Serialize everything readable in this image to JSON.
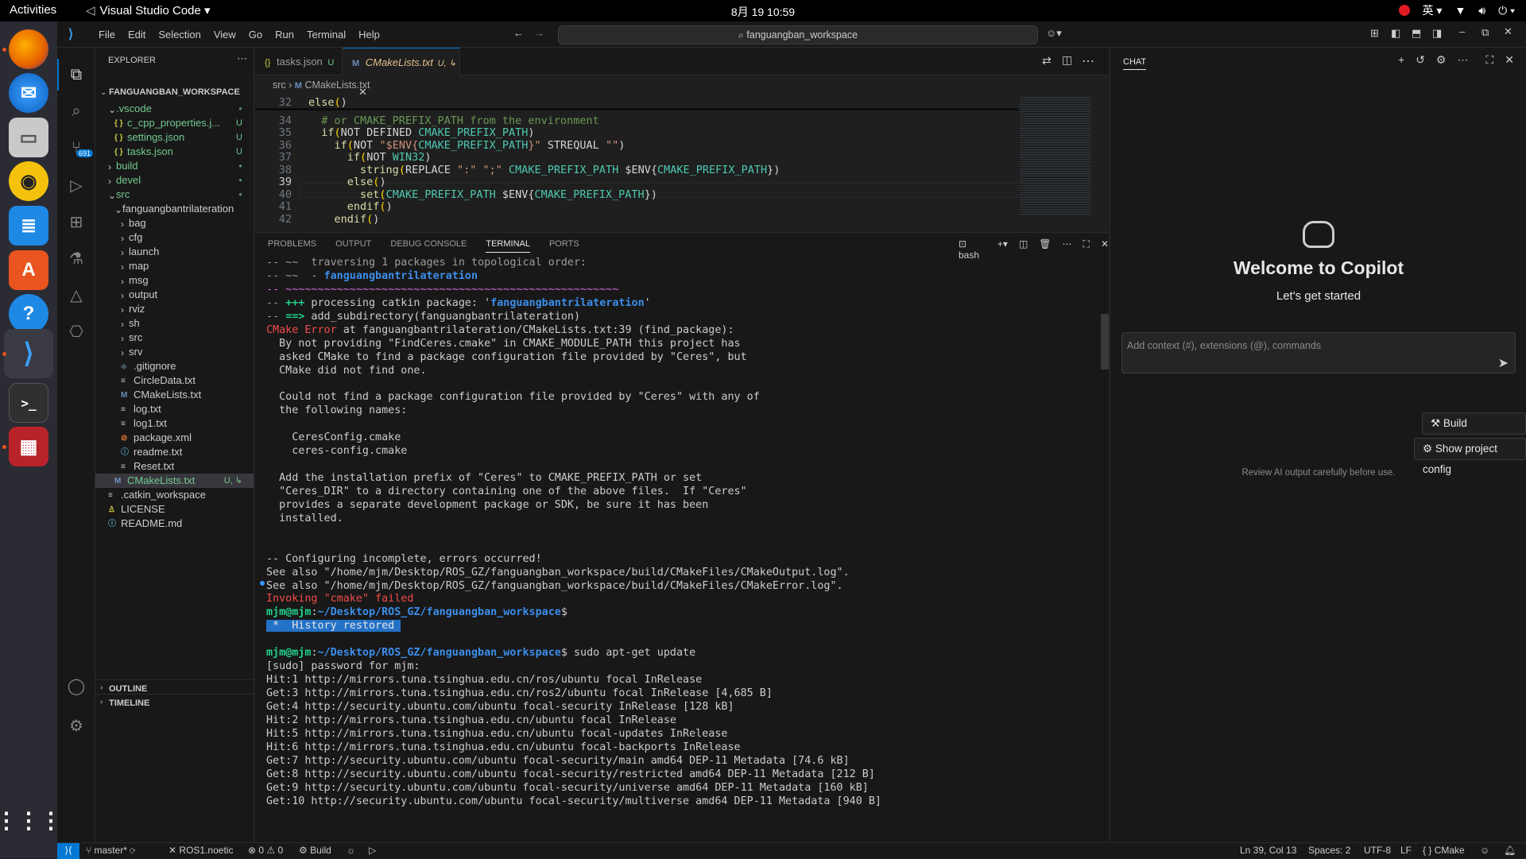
{
  "gnome": {
    "activities": "Activities",
    "app_name": "Visual Studio Code ▾",
    "clock": "8月 19  10:59",
    "input_method": "英 ▾"
  },
  "titlebar": {
    "menu": [
      "File",
      "Edit",
      "Selection",
      "View",
      "Go",
      "Run",
      "Terminal",
      "Help"
    ],
    "search": "fanguangban_workspace"
  },
  "explorer": {
    "header": "EXPLORER",
    "workspace": "FANGUANGBAN_WORKSPACE",
    "items": [
      {
        "label": ".vscode",
        "badge": "●",
        "kind": "folder-open",
        "depth": 1
      },
      {
        "label": "c_cpp_properties.j...",
        "badge": "U",
        "kind": "json",
        "depth": 2
      },
      {
        "label": "settings.json",
        "badge": "U",
        "kind": "json",
        "depth": 2
      },
      {
        "label": "tasks.json",
        "badge": "U",
        "kind": "json",
        "depth": 2
      },
      {
        "label": "build",
        "badge": "●",
        "kind": "folder",
        "depth": 1
      },
      {
        "label": "devel",
        "badge": "●",
        "kind": "folder",
        "depth": 1
      },
      {
        "label": "src",
        "badge": "●",
        "kind": "folder-open",
        "depth": 1
      },
      {
        "label": "fanguangbantrilateration",
        "badge": "",
        "kind": "folder-open",
        "depth": 2
      },
      {
        "label": "bag",
        "badge": "",
        "kind": "folder",
        "depth": 3
      },
      {
        "label": "cfg",
        "badge": "",
        "kind": "folder",
        "depth": 3
      },
      {
        "label": "launch",
        "badge": "",
        "kind": "folder",
        "depth": 3
      },
      {
        "label": "map",
        "badge": "",
        "kind": "folder",
        "depth": 3
      },
      {
        "label": "msg",
        "badge": "",
        "kind": "folder",
        "depth": 3
      },
      {
        "label": "output",
        "badge": "",
        "kind": "folder",
        "depth": 3
      },
      {
        "label": "rviz",
        "badge": "",
        "kind": "folder",
        "depth": 3
      },
      {
        "label": "sh",
        "badge": "",
        "kind": "folder",
        "depth": 3
      },
      {
        "label": "src",
        "badge": "",
        "kind": "folder",
        "depth": 3
      },
      {
        "label": "srv",
        "badge": "",
        "kind": "folder",
        "depth": 3
      },
      {
        "label": ".gitignore",
        "badge": "",
        "kind": "git",
        "depth": 3
      },
      {
        "label": "CircleData.txt",
        "badge": "",
        "kind": "txt",
        "depth": 3
      },
      {
        "label": "CMakeLists.txt",
        "badge": "",
        "kind": "cmake",
        "depth": 3
      },
      {
        "label": "log.txt",
        "badge": "",
        "kind": "txt",
        "depth": 3
      },
      {
        "label": "log1.txt",
        "badge": "",
        "kind": "txt",
        "depth": 3
      },
      {
        "label": "package.xml",
        "badge": "",
        "kind": "rss",
        "depth": 3
      },
      {
        "label": "readme.txt",
        "badge": "",
        "kind": "info",
        "depth": 3
      },
      {
        "label": "Reset.txt",
        "badge": "",
        "kind": "txt",
        "depth": 3
      },
      {
        "label": "CMakeLists.txt",
        "badge": "U, ↳",
        "kind": "cmake",
        "depth": 2
      },
      {
        "label": ".catkin_workspace",
        "badge": "",
        "kind": "txt",
        "depth": 1
      },
      {
        "label": "LICENSE",
        "badge": "",
        "kind": "license",
        "depth": 1
      },
      {
        "label": "README.md",
        "badge": "",
        "kind": "info",
        "depth": 1
      }
    ],
    "outline": "OUTLINE",
    "timeline": "TIMELINE"
  },
  "tabs": [
    {
      "label": "tasks.json",
      "badge": "U",
      "icon": "{}"
    },
    {
      "label": "CMakeLists.txt",
      "badge": "U, ↳",
      "icon": "M"
    }
  ],
  "breadcrumb": {
    "folder": "src",
    "file": "CMakeLists.txt"
  },
  "code": [
    {
      "ln": "32",
      "text": "else()"
    },
    {
      "ln": "34",
      "text": "  # or CMAKE_PREFIX_PATH from the environment"
    },
    {
      "ln": "35",
      "text": "  if(NOT DEFINED CMAKE_PREFIX_PATH)"
    },
    {
      "ln": "36",
      "text": "    if(NOT \"$ENV{CMAKE_PREFIX_PATH}\" STREQUAL \"\")"
    },
    {
      "ln": "37",
      "text": "      if(NOT WIN32)"
    },
    {
      "ln": "38",
      "text": "        string(REPLACE \":\" \";\" CMAKE_PREFIX_PATH $ENV{CMAKE_PREFIX_PATH})"
    },
    {
      "ln": "39",
      "text": "      else()"
    },
    {
      "ln": "40",
      "text": "        set(CMAKE_PREFIX_PATH $ENV{CMAKE_PREFIX_PATH})"
    },
    {
      "ln": "41",
      "text": "      endif()"
    },
    {
      "ln": "42",
      "text": "    endif()"
    }
  ],
  "panel_tabs": [
    "PROBLEMS",
    "OUTPUT",
    "DEBUG CONSOLE",
    "TERMINAL",
    "PORTS"
  ],
  "terminal_shell": "bash",
  "terminal": [
    {
      "cls": "grey",
      "text": "-- ~~  traversing 1 packages in topological order:"
    },
    {
      "cls": "",
      "text": "",
      "parts": [
        [
          "grey",
          "-- ~~  - "
        ],
        [
          "blu",
          "fanguangbantrilateration"
        ]
      ]
    },
    {
      "cls": "mag",
      "text": "-- ~~~~~~~~~~~~~~~~~~~~~~~~~~~~~~~~~~~~~~~~~~~~~~~~~~~~"
    },
    {
      "cls": "",
      "text": "",
      "parts": [
        [
          "grey",
          "-- "
        ],
        [
          "grn",
          "+++"
        ],
        [
          "",
          " processing catkin package: '"
        ],
        [
          "blu",
          "fanguangbantrilateration"
        ],
        [
          "",
          "'"
        ]
      ]
    },
    {
      "cls": "",
      "text": "",
      "parts": [
        [
          "grey",
          "-- "
        ],
        [
          "grn",
          "==>"
        ],
        [
          "",
          " add_subdirectory(fanguangbantrilateration)"
        ]
      ]
    },
    {
      "cls": "",
      "text": "",
      "parts": [
        [
          "red",
          "CMake Error"
        ],
        [
          "",
          " at fanguangbantrilateration/CMakeLists.txt:39 (find_package):"
        ]
      ]
    },
    {
      "cls": "",
      "text": "  By not providing \"FindCeres.cmake\" in CMAKE_MODULE_PATH this project has"
    },
    {
      "cls": "",
      "text": "  asked CMake to find a package configuration file provided by \"Ceres\", but"
    },
    {
      "cls": "",
      "text": "  CMake did not find one."
    },
    {
      "cls": "",
      "text": ""
    },
    {
      "cls": "",
      "text": "  Could not find a package configuration file provided by \"Ceres\" with any of"
    },
    {
      "cls": "",
      "text": "  the following names:"
    },
    {
      "cls": "",
      "text": ""
    },
    {
      "cls": "",
      "text": "    CeresConfig.cmake"
    },
    {
      "cls": "",
      "text": "    ceres-config.cmake"
    },
    {
      "cls": "",
      "text": ""
    },
    {
      "cls": "",
      "text": "  Add the installation prefix of \"Ceres\" to CMAKE_PREFIX_PATH or set"
    },
    {
      "cls": "",
      "text": "  \"Ceres_DIR\" to a directory containing one of the above files.  If \"Ceres\""
    },
    {
      "cls": "",
      "text": "  provides a separate development package or SDK, be sure it has been"
    },
    {
      "cls": "",
      "text": "  installed."
    },
    {
      "cls": "",
      "text": ""
    },
    {
      "cls": "",
      "text": ""
    },
    {
      "cls": "",
      "text": "-- Configuring incomplete, errors occurred!"
    },
    {
      "cls": "",
      "text": "See also \"/home/mjm/Desktop/ROS_GZ/fanguangban_workspace/build/CMakeFiles/CMakeOutput.log\"."
    },
    {
      "cls": "",
      "text": "See also \"/home/mjm/Desktop/ROS_GZ/fanguangban_workspace/build/CMakeFiles/CMakeError.log\"."
    },
    {
      "cls": "",
      "text": "",
      "parts": [
        [
          "red",
          "Invoking "
        ],
        [
          "red",
          "\"cmake\""
        ],
        [
          "red",
          " failed"
        ]
      ]
    },
    {
      "cls": "",
      "text": "",
      "parts": [
        [
          "grn",
          "mjm@mjm"
        ],
        [
          "",
          ":"
        ],
        [
          "blu",
          "~/Desktop/ROS_GZ/fanguangban_workspace"
        ],
        [
          "",
          "$"
        ]
      ]
    },
    {
      "cls": "",
      "text": "",
      "parts": [
        [
          "hist",
          " *  History restored "
        ]
      ]
    },
    {
      "cls": "",
      "text": ""
    },
    {
      "cls": "",
      "text": "",
      "parts": [
        [
          "grn",
          "mjm@mjm"
        ],
        [
          "",
          ":"
        ],
        [
          "blu",
          "~/Desktop/ROS_GZ/fanguangban_workspace"
        ],
        [
          "",
          "$ sudo apt-get update"
        ]
      ]
    },
    {
      "cls": "",
      "text": "[sudo] password for mjm:"
    },
    {
      "cls": "",
      "text": "Hit:1 http://mirrors.tuna.tsinghua.edu.cn/ros/ubuntu focal InRelease"
    },
    {
      "cls": "",
      "text": "Get:3 http://mirrors.tuna.tsinghua.edu.cn/ros2/ubuntu focal InRelease [4,685 B]"
    },
    {
      "cls": "",
      "text": "Get:4 http://security.ubuntu.com/ubuntu focal-security InRelease [128 kB]"
    },
    {
      "cls": "",
      "text": "Hit:2 http://mirrors.tuna.tsinghua.edu.cn/ubuntu focal InRelease"
    },
    {
      "cls": "",
      "text": "Hit:5 http://mirrors.tuna.tsinghua.edu.cn/ubuntu focal-updates InRelease"
    },
    {
      "cls": "",
      "text": "Hit:6 http://mirrors.tuna.tsinghua.edu.cn/ubuntu focal-backports InRelease"
    },
    {
      "cls": "",
      "text": "Get:7 http://security.ubuntu.com/ubuntu focal-security/main amd64 DEP-11 Metadata [74.6 kB]"
    },
    {
      "cls": "",
      "text": "Get:8 http://security.ubuntu.com/ubuntu focal-security/restricted amd64 DEP-11 Metadata [212 B]"
    },
    {
      "cls": "",
      "text": "Get:9 http://security.ubuntu.com/ubuntu focal-security/universe amd64 DEP-11 Metadata [160 kB]"
    },
    {
      "cls": "",
      "text": "Get:10 http://security.ubuntu.com/ubuntu focal-security/multiverse amd64 DEP-11 Metadata [940 B]"
    }
  ],
  "chat": {
    "header": "CHAT",
    "welcome": "Welcome to Copilot",
    "subtitle": "Let's get started",
    "input_placeholder": "Add context (#), extensions (@), commands",
    "build_button": "Build workspace",
    "config_button": "Show project config",
    "disclaimer": "Review AI output carefully before use."
  },
  "status": {
    "branch": "master*",
    "ros": "ROS1.noetic",
    "problems": "⊗ 0 ⚠ 0",
    "build": "Build",
    "position": "Ln 39, Col 13",
    "spaces": "Spaces: 2",
    "encoding": "UTF-8",
    "eol": "LF",
    "language": "CMake"
  },
  "colors": {
    "accent": "#0078d4",
    "untracked": "#73c991",
    "error": "#f14c4c"
  }
}
